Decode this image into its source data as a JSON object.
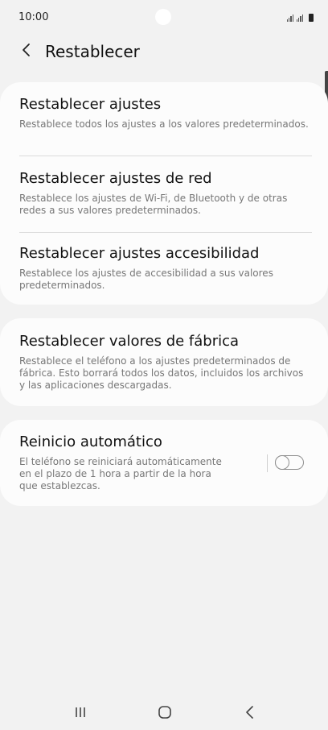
{
  "status_bar": {
    "time": "10:00"
  },
  "header": {
    "title": "Restablecer",
    "back_icon": "chevron-left-icon"
  },
  "reset_group": {
    "items": [
      {
        "title": "Restablecer ajustes",
        "description": "Restablece todos los ajustes a los valores predeterminados."
      },
      {
        "title": "Restablecer ajustes de red",
        "description": "Restablece los ajustes de Wi-Fi, de Bluetooth y de otras redes a sus valores predeterminados."
      },
      {
        "title": "Restablecer ajustes accesibilidad",
        "description": "Restablece los ajustes de accesibilidad a sus valores predeterminados."
      }
    ]
  },
  "factory_reset": {
    "title": "Restablecer valores de fábrica",
    "description": "Restablece el teléfono a los ajustes predeterminados de fábrica. Esto borrará todos los datos, incluidos los archivos y las aplicaciones descargadas."
  },
  "auto_restart": {
    "title": "Reinicio automático",
    "description": "El teléfono se reiniciará automáticamente en el plazo de 1 hora a partir de la hora que establezcas.",
    "enabled": false
  },
  "nav_bar": {
    "recent_icon": "recent-apps-icon",
    "home_icon": "home-icon",
    "back_icon": "back-icon"
  },
  "colors": {
    "background": "#f2f2f2",
    "card": "#fcfcfc",
    "title_text": "#111111",
    "secondary_text": "#777777"
  }
}
